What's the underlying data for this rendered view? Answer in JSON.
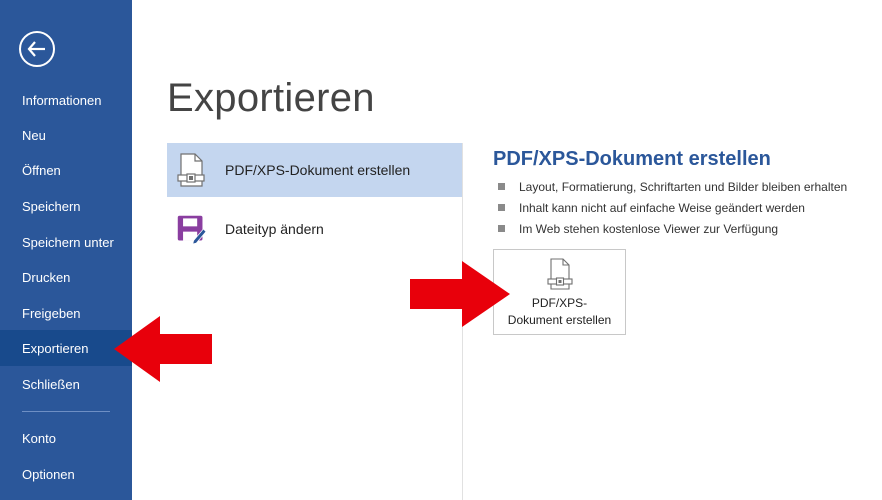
{
  "sidebar": {
    "back_label": "Zurück",
    "items": [
      {
        "label": "Informationen",
        "active": false
      },
      {
        "label": "Neu",
        "active": false
      },
      {
        "label": "Öffnen",
        "active": false
      },
      {
        "label": "Speichern",
        "active": false
      },
      {
        "label": "Speichern unter",
        "active": false
      },
      {
        "label": "Drucken",
        "active": false
      },
      {
        "label": "Freigeben",
        "active": false
      },
      {
        "label": "Exportieren",
        "active": true
      },
      {
        "label": "Schließen",
        "active": false
      }
    ],
    "bottom_items": [
      {
        "label": "Konto"
      },
      {
        "label": "Optionen"
      }
    ]
  },
  "main": {
    "title": "Exportieren",
    "options": [
      {
        "label": "PDF/XPS-Dokument erstellen",
        "icon": "pdf-document-icon",
        "selected": true
      },
      {
        "label": "Dateityp ändern",
        "icon": "change-filetype-icon",
        "selected": false
      }
    ],
    "detail": {
      "title": "PDF/XPS-Dokument erstellen",
      "bullets": [
        "Layout, Formatierung, Schriftarten und Bilder bleiben erhalten",
        "Inhalt kann nicht auf einfache Weise geändert werden",
        "Im Web stehen kostenlose Viewer zur Verfügung"
      ],
      "button": {
        "line1": "PDF/XPS-",
        "line2": "Dokument erstellen",
        "icon": "pdf-document-icon"
      }
    }
  },
  "colors": {
    "sidebar_bg": "#2b579a",
    "sidebar_active": "#184a8c",
    "selected_option": "#c4d6ef",
    "accent_text": "#2b579a",
    "annotation_arrow": "#e8000b"
  }
}
